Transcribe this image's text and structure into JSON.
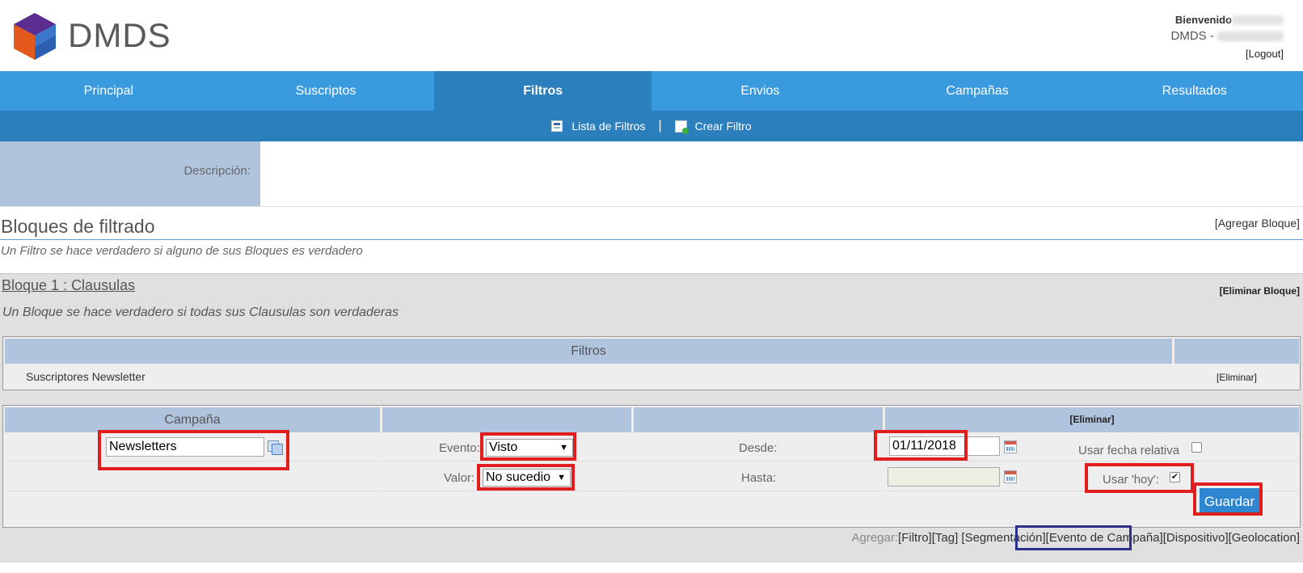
{
  "header": {
    "logo_text": "DMDS",
    "welcome": "Bienvenido",
    "app_version_prefix": "DMDS -",
    "logout": "[Logout]"
  },
  "nav": {
    "tabs": [
      {
        "label": "Principal"
      },
      {
        "label": "Suscriptos"
      },
      {
        "label": "Filtros"
      },
      {
        "label": "Envios"
      },
      {
        "label": "Campañas"
      },
      {
        "label": "Resultados"
      }
    ],
    "active": "Filtros"
  },
  "subnav": {
    "list_label": "Lista de Filtros",
    "separator": "|",
    "create_label": "Crear Filtro"
  },
  "form": {
    "description_label": "Descripción:"
  },
  "section": {
    "title": "Bloques de filtrado",
    "add_block": "[Agregar Bloque]",
    "subtitle": "Un Filtro se hace verdadero si alguno de sus Bloques es verdadero"
  },
  "block": {
    "title": "Bloque 1 : Clausulas",
    "delete_block": "[Eliminar Bloque]",
    "subtitle": "Un Bloque se hace verdadero si todas sus Clausulas son verdaderas",
    "filters_table": {
      "header": "Filtros",
      "row_name": "Suscriptores Newsletter",
      "row_action": "[Eliminar]"
    },
    "clause": {
      "header_campaign": "Campaña",
      "header_delete": "[Eliminar]",
      "campaign_value": "Newsletters",
      "event_label": "Evento:",
      "event_value": "Visto",
      "value_label": "Valor:",
      "value_value": "No sucedio",
      "from_label": "Desde:",
      "from_value": "01/11/2018",
      "to_label": "Hasta:",
      "to_value": "",
      "relative_date_label": "Usar fecha relativa",
      "relative_date_checked": false,
      "use_today_label": "Usar 'hoy':",
      "use_today_checked": true,
      "save_button": "Guardar"
    },
    "add_row": {
      "prefix": "Agregar:",
      "links": [
        "[Filtro]",
        "[Tag]",
        "[Segmentación]",
        "[Evento de Campaña]",
        "[Dispositivo]",
        "[Geolocation]"
      ]
    }
  },
  "colors": {
    "nav_bg": "#3a9ade",
    "nav_active": "#2b7fbd",
    "header_cell": "#b0c4de",
    "highlight_red": "#e01e1e",
    "highlight_blue": "#2c2f8c",
    "save_button": "#2e86d0"
  }
}
